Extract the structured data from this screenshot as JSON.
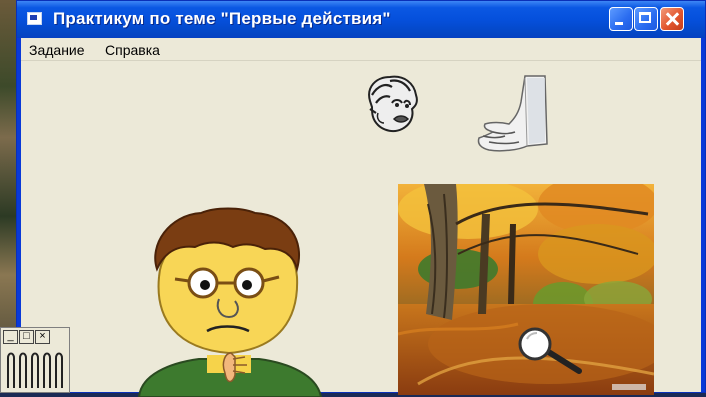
{
  "window": {
    "title": "Практикум по теме \"Первые действия\"",
    "buttons": {
      "minimize": "minimize",
      "maximize": "maximize",
      "close": "close"
    }
  },
  "menu": {
    "items": [
      "Задание",
      "Справка"
    ]
  },
  "scene": {
    "icons": [
      "scared-face-icon",
      "hand-icon",
      "boy-character",
      "autumn-forest-picture",
      "magnifier-icon"
    ]
  },
  "mini_window": {
    "buttons": [
      "minimize",
      "maximize",
      "close"
    ],
    "icon": "springs-icon"
  }
}
